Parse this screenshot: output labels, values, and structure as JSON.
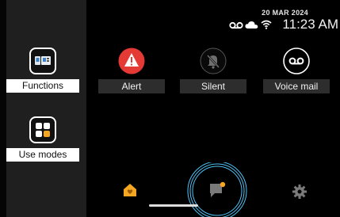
{
  "status": {
    "date": "20 MAR 2024",
    "time": "11:23 AM",
    "icons": [
      "voicemail-icon",
      "cloud-icon",
      "wifi-icon"
    ]
  },
  "sidebar": {
    "items": [
      {
        "label": "Functions",
        "icon": "functions-icon"
      },
      {
        "label": "Use modes",
        "icon": "use-modes-icon"
      }
    ]
  },
  "main": {
    "tiles": [
      {
        "label": "Alert",
        "icon": "alert-icon"
      },
      {
        "label": "Silent",
        "icon": "silent-icon"
      },
      {
        "label": "Voice mail",
        "icon": "voicemail-icon"
      }
    ]
  },
  "nav": {
    "items": [
      "home-icon",
      "messages-icon",
      "settings-icon"
    ]
  },
  "colors": {
    "alert": "#e53935",
    "accent": "#f5a623",
    "ring": "#4fc3f7"
  }
}
